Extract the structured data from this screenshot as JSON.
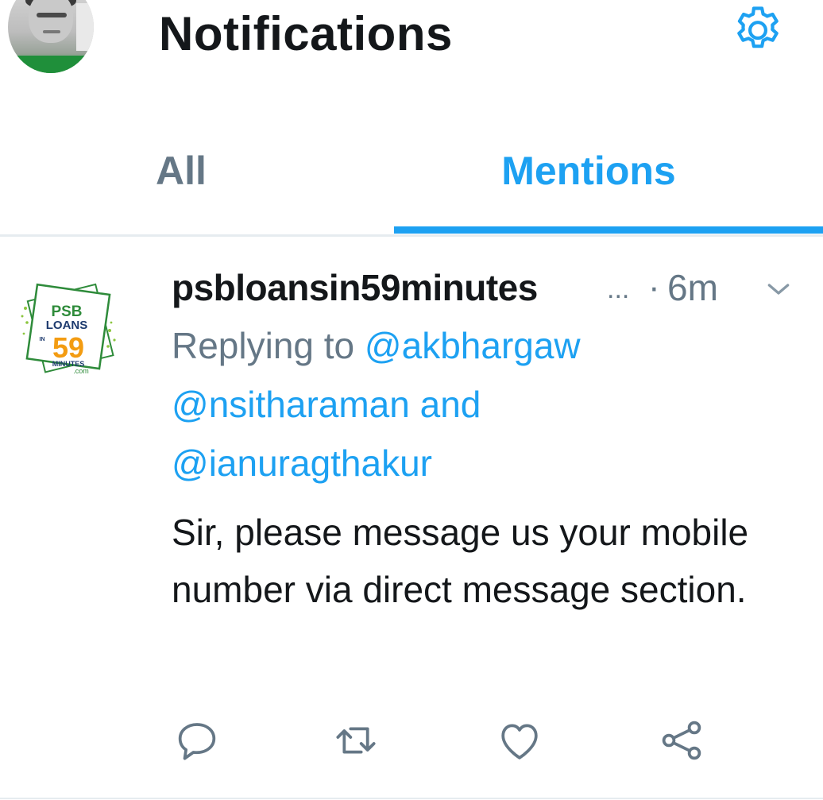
{
  "header": {
    "title": "Notifications",
    "avatar_icon": "user-avatar",
    "settings_icon": "gear-icon"
  },
  "tabs": [
    {
      "label": "All",
      "active": false
    },
    {
      "label": "Mentions",
      "active": true
    }
  ],
  "tweet": {
    "author": "psbloansin59minutes",
    "truncation": "...",
    "separator": "·",
    "time": "6m",
    "avatar_logo": {
      "line1": "PSB",
      "line2": "LOANS",
      "in": "IN",
      "number": "59",
      "line3": "MINUTES",
      "line4": ".com"
    },
    "replying_prefix": "Replying to",
    "mentions": [
      "@akbhargaw",
      "@nsitharaman",
      "@ianuragthakur"
    ],
    "and_word": "and",
    "text": "Sir, please message us your mobile number via direct message section.",
    "actions": [
      "reply-icon",
      "retweet-icon",
      "like-icon",
      "share-icon"
    ]
  },
  "colors": {
    "accent": "#1da1f2",
    "secondary_text": "#657786",
    "primary_text": "#14171a",
    "divider": "#e6ecf0"
  }
}
